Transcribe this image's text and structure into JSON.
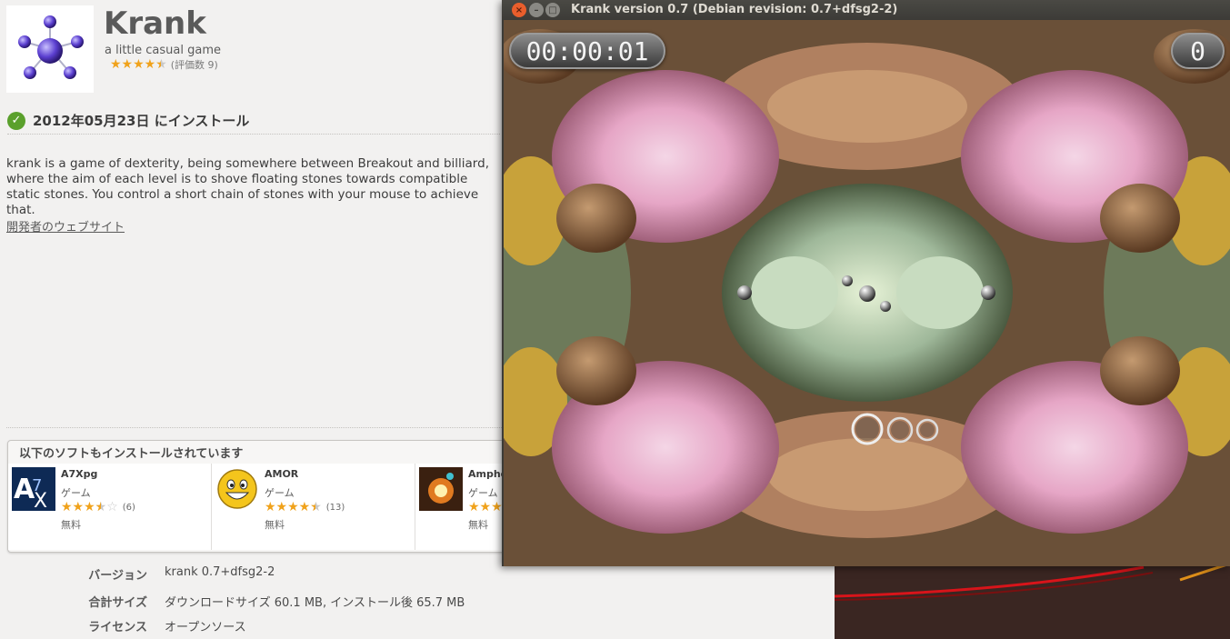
{
  "software_center": {
    "app": {
      "title": "Krank",
      "tagline": "a little casual game",
      "rating_count_text": "(評価数 9)",
      "stars": 4.5
    },
    "installed_text": "2012年05月23日 にインストール",
    "description": "krank is a game of dexterity, being somewhere between Breakout and billiard, where the aim of each level is to shove floating stones towards compatible static stones. You control a short chain of stones with your mouse to achieve that.",
    "developer_link": "開発者のウェブサイト",
    "also_installed": {
      "title": "以下のソフトもインストールされています",
      "items": [
        {
          "name": "A7Xpg",
          "category": "ゲーム",
          "stars": 3.5,
          "count": "(6)",
          "price": "無料"
        },
        {
          "name": "AMOR",
          "category": "ゲーム",
          "stars": 4.5,
          "count": "(13)",
          "price": "無料"
        },
        {
          "name": "Amphe",
          "category": "ゲーム",
          "stars": 4,
          "count": "",
          "price": "無料"
        }
      ]
    },
    "details": [
      {
        "label": "バージョン",
        "value": "krank 0.7+dfsg2-2"
      },
      {
        "label": "合計サイズ",
        "value": "ダウンロードサイズ 60.1 MB, インストール後 65.7 MB"
      },
      {
        "label": "ライセンス",
        "value": "オープンソース"
      }
    ]
  },
  "krank_window": {
    "title": "Krank version 0.7 (Debian revision: 0.7+dfsg2-2)",
    "timer": "00:00:01",
    "score": "0"
  },
  "colors": {
    "star": "#f0a21b",
    "check": "#5aa02c",
    "close_button": "#e95e2c",
    "titlebar": "#3c3b37"
  }
}
